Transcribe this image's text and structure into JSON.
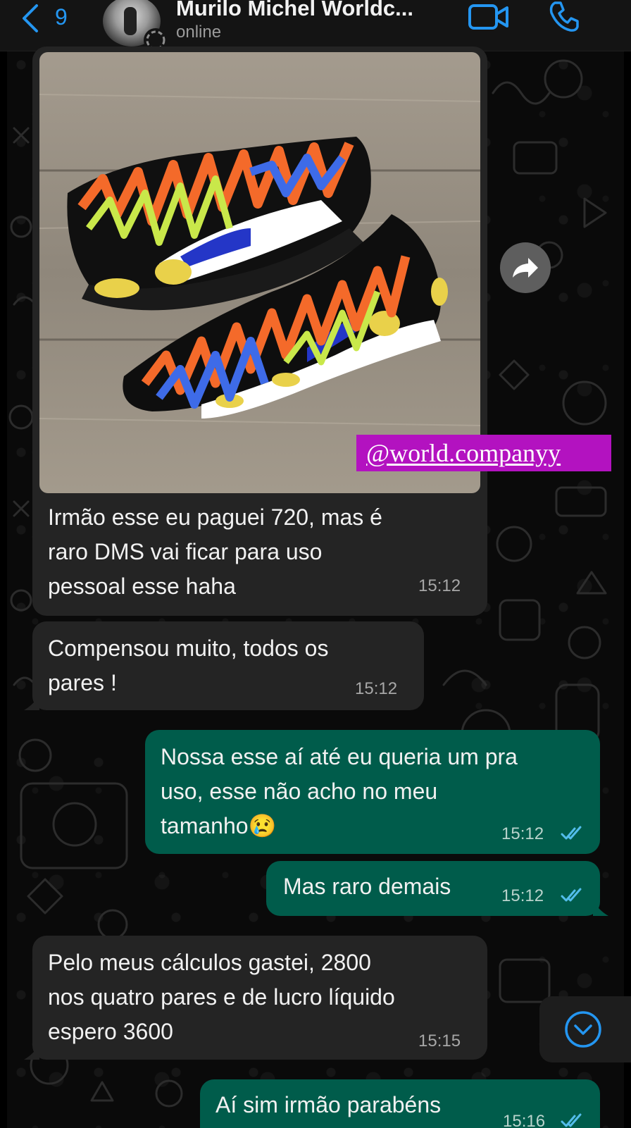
{
  "header": {
    "back_count": "9",
    "contact_name": "Murilo Michel Worldc...",
    "contact_status": "online"
  },
  "image_message": {
    "watermark": "@world.companyy",
    "caption": [
      "Irmão esse eu paguei 720, mas é",
      "raro DMS vai ficar para uso",
      "pessoal esse haha"
    ],
    "time": "15:12"
  },
  "messages": [
    {
      "id": "m2",
      "direction": "incoming",
      "lines": [
        "Compensou muito, todos os",
        "pares !"
      ],
      "time": "15:12"
    },
    {
      "id": "m3",
      "direction": "outgoing",
      "lines": [
        "Nossa esse aí até eu queria um pra",
        "uso, esse não acho no meu",
        "tamanho😢"
      ],
      "time": "15:12",
      "status": "read"
    },
    {
      "id": "m4",
      "direction": "outgoing",
      "lines": [
        "Mas raro demais"
      ],
      "time": "15:12",
      "status": "read"
    },
    {
      "id": "m5",
      "direction": "incoming",
      "lines": [
        "Pelo meus cálculos gastei, 2800",
        "nos quatro pares e de lucro líquido",
        "espero 3600"
      ],
      "time": "15:15"
    },
    {
      "id": "m6",
      "direction": "outgoing",
      "lines": [
        "Aí sim irmão parabéns"
      ],
      "time": "15:16",
      "status": "read"
    }
  ],
  "colors": {
    "accent": "#2496f1",
    "incoming_bubble": "#242424",
    "outgoing_bubble": "#005c4b",
    "read_ticks": "#53bdeb",
    "watermark_bg": "#b312c0"
  },
  "icons": [
    "back-chevron-icon",
    "status-ring-icon",
    "video-call-icon",
    "phone-call-icon",
    "forward-icon",
    "chevron-down-icon",
    "double-check-icon"
  ]
}
